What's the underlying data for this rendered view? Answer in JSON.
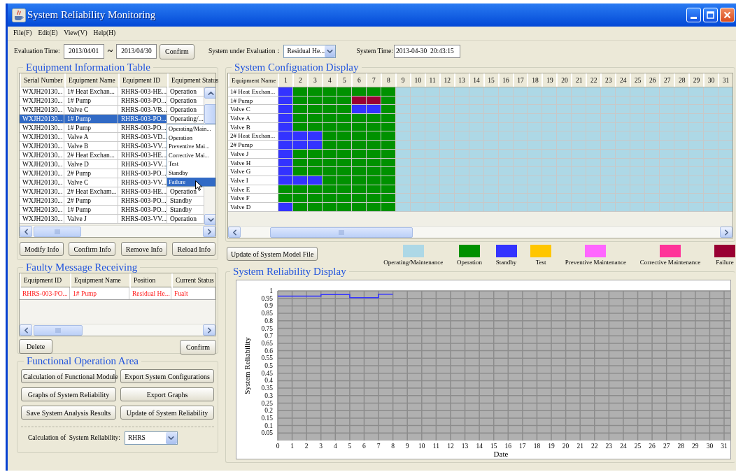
{
  "window": {
    "title": "System Reliability Monitoring"
  },
  "menu": [
    "File(F)",
    "Edit(E)",
    "View(V)",
    "Help(H)"
  ],
  "toolbar": {
    "evaluation_label": "Evaluation Time:",
    "start_date": "2013/04/01",
    "separator": "~",
    "end_date": "2013/04/30",
    "confirm_button": "Confirm",
    "system_label": "System under Evaluation：",
    "system_value": "Residual He...",
    "time_label": "System Time:",
    "time_value": "2013-04-30  20:43:15"
  },
  "equipment_table": {
    "title": "Equipment Information Table",
    "columns": [
      "Serial Number",
      "Equipment Name",
      "Equipment ID",
      "Equipment Status"
    ],
    "rows": [
      {
        "serial": "WXJH20130...",
        "name": "1# Heat Exchan...",
        "id": "RHRS-003-HE...",
        "status": "Operation",
        "selected": false
      },
      {
        "serial": "WXJH20130...",
        "name": "1# Pump",
        "id": "RHRS-003-PO...",
        "status": "Operation",
        "selected": false
      },
      {
        "serial": "WXJH20130...",
        "name": "Valve C",
        "id": "RHRS-003-VB...",
        "status": "Operation",
        "selected": false
      },
      {
        "serial": "WXJH20130...",
        "name": "1# Pump",
        "id": "RHRS-003-PO...",
        "status": "Operating/...",
        "selected": true
      },
      {
        "serial": "WXJH20130...",
        "name": "1# Pump",
        "id": "RHRS-003-PO...",
        "selected": false
      },
      {
        "serial": "WXJH20130...",
        "name": "Valve A",
        "id": "RHRS-003-VD...",
        "selected": false
      },
      {
        "serial": "WXJH20130...",
        "name": "Valve B",
        "id": "RHRS-003-VV...",
        "selected": false
      },
      {
        "serial": "WXJH20130...",
        "name": "2# Heat Exchan...",
        "id": "RHRS-003-HE...",
        "selected": false
      },
      {
        "serial": "WXJH20130...",
        "name": "Valve D",
        "id": "RHRS-003-VV...",
        "selected": false
      },
      {
        "serial": "WXJH20130...",
        "name": "2# Pump",
        "id": "RHRS-003-PO...",
        "selected": false
      },
      {
        "serial": "WXJH20130...",
        "name": "Valve C",
        "id": "RHRS-003-VV...",
        "selected": false
      },
      {
        "serial": "WXJH20130...",
        "name": "2# Heat Excham...",
        "id": "RHRS-003-HE...",
        "status": "Operation",
        "selected": false
      },
      {
        "serial": "WXJH20130...",
        "name": "2# Pump",
        "id": "RHRS-003-PO...",
        "status": "Standby",
        "selected": false
      },
      {
        "serial": "WXJH20130...",
        "name": "1# Pump",
        "id": "RHRS-003-PO...",
        "status": "Standby",
        "selected": false
      },
      {
        "serial": "WXJH20130...",
        "name": "Valve J",
        "id": "RHRS-003-VV...",
        "status": "Operation",
        "selected": false
      }
    ],
    "status_menu": [
      {
        "label": "Operating/Main...",
        "selected": false
      },
      {
        "label": "Operation",
        "selected": false
      },
      {
        "label": "Preventive Mai...",
        "selected": false
      },
      {
        "label": "Corrective Mai...",
        "selected": false
      },
      {
        "label": "Test",
        "selected": false
      },
      {
        "label": "Standby",
        "selected": false
      },
      {
        "label": "Failure",
        "selected": true
      }
    ],
    "buttons": [
      "Modify Info",
      "Confirm Info",
      "Remove Info",
      "Reload Info"
    ]
  },
  "configuration": {
    "title": "System Configuation Display",
    "name_header": "Equipment Name",
    "days": [
      "1",
      "2",
      "3",
      "4",
      "5",
      "6",
      "7",
      "8",
      "9",
      "10",
      "11",
      "12",
      "13",
      "14",
      "15",
      "16",
      "17",
      "18",
      "19",
      "20",
      "21",
      "22",
      "23",
      "24",
      "25",
      "26",
      "27",
      "28",
      "29",
      "30",
      "31"
    ],
    "rows": [
      {
        "name": "1# Heat Exchan...",
        "cells": [
          {
            "kind": "sb"
          },
          {
            "kind": "op"
          },
          {
            "kind": "op"
          },
          {
            "kind": "op"
          },
          {
            "kind": "op"
          },
          {
            "kind": "op"
          },
          {
            "kind": "op"
          },
          {
            "kind": "op"
          },
          {
            "kind": "om"
          },
          {
            "kind": "om"
          },
          {
            "kind": "om"
          },
          {
            "kind": "om"
          },
          {
            "kind": "om"
          },
          {
            "kind": "om"
          },
          {
            "kind": "om"
          },
          {
            "kind": "om"
          },
          {
            "kind": "om"
          },
          {
            "kind": "om"
          },
          {
            "kind": "om"
          },
          {
            "kind": "om"
          },
          {
            "kind": "om"
          },
          {
            "kind": "om"
          },
          {
            "kind": "om"
          },
          {
            "kind": "om"
          },
          {
            "kind": "om"
          },
          {
            "kind": "om"
          },
          {
            "kind": "om"
          },
          {
            "kind": "om"
          },
          {
            "kind": "om"
          },
          {
            "kind": "om"
          },
          {
            "kind": "om"
          }
        ]
      },
      {
        "name": "1# Pump",
        "cells": [
          {
            "kind": "sb"
          },
          {
            "kind": "op"
          },
          {
            "kind": "op"
          },
          {
            "kind": "op"
          },
          {
            "kind": "op"
          },
          {
            "kind": "fl"
          },
          {
            "kind": "fl"
          },
          {
            "kind": "op"
          },
          {
            "kind": "om"
          },
          {
            "kind": "om"
          },
          {
            "kind": "om"
          },
          {
            "kind": "om"
          },
          {
            "kind": "om"
          },
          {
            "kind": "om"
          },
          {
            "kind": "om"
          },
          {
            "kind": "om"
          },
          {
            "kind": "om"
          },
          {
            "kind": "om"
          },
          {
            "kind": "om"
          },
          {
            "kind": "om"
          },
          {
            "kind": "om"
          },
          {
            "kind": "om"
          },
          {
            "kind": "om"
          },
          {
            "kind": "om"
          },
          {
            "kind": "om"
          },
          {
            "kind": "om"
          },
          {
            "kind": "om"
          },
          {
            "kind": "om"
          },
          {
            "kind": "om"
          },
          {
            "kind": "om"
          },
          {
            "kind": "om"
          }
        ]
      },
      {
        "name": "Valve C",
        "cells": [
          {
            "kind": "sb"
          },
          {
            "kind": "op"
          },
          {
            "kind": "op"
          },
          {
            "kind": "op"
          },
          {
            "kind": "op"
          },
          {
            "kind": "sb"
          },
          {
            "kind": "sb"
          },
          {
            "kind": "op"
          },
          {
            "kind": "om"
          },
          {
            "kind": "om"
          },
          {
            "kind": "om"
          },
          {
            "kind": "om"
          },
          {
            "kind": "om"
          },
          {
            "kind": "om"
          },
          {
            "kind": "om"
          },
          {
            "kind": "om"
          },
          {
            "kind": "om"
          },
          {
            "kind": "om"
          },
          {
            "kind": "om"
          },
          {
            "kind": "om"
          },
          {
            "kind": "om"
          },
          {
            "kind": "om"
          },
          {
            "kind": "om"
          },
          {
            "kind": "om"
          },
          {
            "kind": "om"
          },
          {
            "kind": "om"
          },
          {
            "kind": "om"
          },
          {
            "kind": "om"
          },
          {
            "kind": "om"
          },
          {
            "kind": "om"
          },
          {
            "kind": "om"
          }
        ]
      },
      {
        "name": "Valve A",
        "cells": [
          {
            "kind": "sb"
          },
          {
            "kind": "op"
          },
          {
            "kind": "op"
          },
          {
            "kind": "op"
          },
          {
            "kind": "op"
          },
          {
            "kind": "op"
          },
          {
            "kind": "op"
          },
          {
            "kind": "op"
          },
          {
            "kind": "om"
          },
          {
            "kind": "om"
          },
          {
            "kind": "om"
          },
          {
            "kind": "om"
          },
          {
            "kind": "om"
          },
          {
            "kind": "om"
          },
          {
            "kind": "om"
          },
          {
            "kind": "om"
          },
          {
            "kind": "om"
          },
          {
            "kind": "om"
          },
          {
            "kind": "om"
          },
          {
            "kind": "om"
          },
          {
            "kind": "om"
          },
          {
            "kind": "om"
          },
          {
            "kind": "om"
          },
          {
            "kind": "om"
          },
          {
            "kind": "om"
          },
          {
            "kind": "om"
          },
          {
            "kind": "om"
          },
          {
            "kind": "om"
          },
          {
            "kind": "om"
          },
          {
            "kind": "om"
          },
          {
            "kind": "om"
          }
        ]
      },
      {
        "name": "Valve B",
        "cells": [
          {
            "kind": "sb"
          },
          {
            "kind": "op"
          },
          {
            "kind": "op"
          },
          {
            "kind": "op"
          },
          {
            "kind": "op"
          },
          {
            "kind": "op"
          },
          {
            "kind": "op"
          },
          {
            "kind": "op"
          },
          {
            "kind": "om"
          },
          {
            "kind": "om"
          },
          {
            "kind": "om"
          },
          {
            "kind": "om"
          },
          {
            "kind": "om"
          },
          {
            "kind": "om"
          },
          {
            "kind": "om"
          },
          {
            "kind": "om"
          },
          {
            "kind": "om"
          },
          {
            "kind": "om"
          },
          {
            "kind": "om"
          },
          {
            "kind": "om"
          },
          {
            "kind": "om"
          },
          {
            "kind": "om"
          },
          {
            "kind": "om"
          },
          {
            "kind": "om"
          },
          {
            "kind": "om"
          },
          {
            "kind": "om"
          },
          {
            "kind": "om"
          },
          {
            "kind": "om"
          },
          {
            "kind": "om"
          },
          {
            "kind": "om"
          },
          {
            "kind": "om"
          }
        ]
      },
      {
        "name": "2# Heat Exchan...",
        "cells": [
          {
            "kind": "sb"
          },
          {
            "kind": "sb"
          },
          {
            "kind": "sb"
          },
          {
            "kind": "op"
          },
          {
            "kind": "op"
          },
          {
            "kind": "op"
          },
          {
            "kind": "op"
          },
          {
            "kind": "op"
          },
          {
            "kind": "om"
          },
          {
            "kind": "om"
          },
          {
            "kind": "om"
          },
          {
            "kind": "om"
          },
          {
            "kind": "om"
          },
          {
            "kind": "om"
          },
          {
            "kind": "om"
          },
          {
            "kind": "om"
          },
          {
            "kind": "om"
          },
          {
            "kind": "om"
          },
          {
            "kind": "om"
          },
          {
            "kind": "om"
          },
          {
            "kind": "om"
          },
          {
            "kind": "om"
          },
          {
            "kind": "om"
          },
          {
            "kind": "om"
          },
          {
            "kind": "om"
          },
          {
            "kind": "om"
          },
          {
            "kind": "om"
          },
          {
            "kind": "om"
          },
          {
            "kind": "om"
          },
          {
            "kind": "om"
          },
          {
            "kind": "om"
          }
        ]
      },
      {
        "name": "2# Pump",
        "cells": [
          {
            "kind": "sb"
          },
          {
            "kind": "sb"
          },
          {
            "kind": "sb"
          },
          {
            "kind": "op"
          },
          {
            "kind": "op"
          },
          {
            "kind": "op"
          },
          {
            "kind": "op"
          },
          {
            "kind": "op"
          },
          {
            "kind": "om"
          },
          {
            "kind": "om"
          },
          {
            "kind": "om"
          },
          {
            "kind": "om"
          },
          {
            "kind": "om"
          },
          {
            "kind": "om"
          },
          {
            "kind": "om"
          },
          {
            "kind": "om"
          },
          {
            "kind": "om"
          },
          {
            "kind": "om"
          },
          {
            "kind": "om"
          },
          {
            "kind": "om"
          },
          {
            "kind": "om"
          },
          {
            "kind": "om"
          },
          {
            "kind": "om"
          },
          {
            "kind": "om"
          },
          {
            "kind": "om"
          },
          {
            "kind": "om"
          },
          {
            "kind": "om"
          },
          {
            "kind": "om"
          },
          {
            "kind": "om"
          },
          {
            "kind": "om"
          },
          {
            "kind": "om"
          }
        ]
      },
      {
        "name": "Valve J",
        "cells": [
          {
            "kind": "sb"
          },
          {
            "kind": "op"
          },
          {
            "kind": "op"
          },
          {
            "kind": "op"
          },
          {
            "kind": "op"
          },
          {
            "kind": "op"
          },
          {
            "kind": "op"
          },
          {
            "kind": "op"
          },
          {
            "kind": "om"
          },
          {
            "kind": "om"
          },
          {
            "kind": "om"
          },
          {
            "kind": "om"
          },
          {
            "kind": "om"
          },
          {
            "kind": "om"
          },
          {
            "kind": "om"
          },
          {
            "kind": "om"
          },
          {
            "kind": "om"
          },
          {
            "kind": "om"
          },
          {
            "kind": "om"
          },
          {
            "kind": "om"
          },
          {
            "kind": "om"
          },
          {
            "kind": "om"
          },
          {
            "kind": "om"
          },
          {
            "kind": "om"
          },
          {
            "kind": "om"
          },
          {
            "kind": "om"
          },
          {
            "kind": "om"
          },
          {
            "kind": "om"
          },
          {
            "kind": "om"
          },
          {
            "kind": "om"
          },
          {
            "kind": "om"
          }
        ]
      },
      {
        "name": "Valve H",
        "cells": [
          {
            "kind": "sb"
          },
          {
            "kind": "op"
          },
          {
            "kind": "op"
          },
          {
            "kind": "op"
          },
          {
            "kind": "op"
          },
          {
            "kind": "op"
          },
          {
            "kind": "op"
          },
          {
            "kind": "op"
          },
          {
            "kind": "om"
          },
          {
            "kind": "om"
          },
          {
            "kind": "om"
          },
          {
            "kind": "om"
          },
          {
            "kind": "om"
          },
          {
            "kind": "om"
          },
          {
            "kind": "om"
          },
          {
            "kind": "om"
          },
          {
            "kind": "om"
          },
          {
            "kind": "om"
          },
          {
            "kind": "om"
          },
          {
            "kind": "om"
          },
          {
            "kind": "om"
          },
          {
            "kind": "om"
          },
          {
            "kind": "om"
          },
          {
            "kind": "om"
          },
          {
            "kind": "om"
          },
          {
            "kind": "om"
          },
          {
            "kind": "om"
          },
          {
            "kind": "om"
          },
          {
            "kind": "om"
          },
          {
            "kind": "om"
          },
          {
            "kind": "om"
          }
        ]
      },
      {
        "name": "Valve G",
        "cells": [
          {
            "kind": "sb"
          },
          {
            "kind": "op"
          },
          {
            "kind": "op"
          },
          {
            "kind": "op"
          },
          {
            "kind": "op"
          },
          {
            "kind": "op"
          },
          {
            "kind": "op"
          },
          {
            "kind": "op"
          },
          {
            "kind": "om"
          },
          {
            "kind": "om"
          },
          {
            "kind": "om"
          },
          {
            "kind": "om"
          },
          {
            "kind": "om"
          },
          {
            "kind": "om"
          },
          {
            "kind": "om"
          },
          {
            "kind": "om"
          },
          {
            "kind": "om"
          },
          {
            "kind": "om"
          },
          {
            "kind": "om"
          },
          {
            "kind": "om"
          },
          {
            "kind": "om"
          },
          {
            "kind": "om"
          },
          {
            "kind": "om"
          },
          {
            "kind": "om"
          },
          {
            "kind": "om"
          },
          {
            "kind": "om"
          },
          {
            "kind": "om"
          },
          {
            "kind": "om"
          },
          {
            "kind": "om"
          },
          {
            "kind": "om"
          },
          {
            "kind": "om"
          }
        ]
      },
      {
        "name": "Valve I",
        "cells": [
          {
            "kind": "sb"
          },
          {
            "kind": "sb"
          },
          {
            "kind": "sb"
          },
          {
            "kind": "op"
          },
          {
            "kind": "op"
          },
          {
            "kind": "op"
          },
          {
            "kind": "op"
          },
          {
            "kind": "op"
          },
          {
            "kind": "om"
          },
          {
            "kind": "om"
          },
          {
            "kind": "om"
          },
          {
            "kind": "om"
          },
          {
            "kind": "om"
          },
          {
            "kind": "om"
          },
          {
            "kind": "om"
          },
          {
            "kind": "om"
          },
          {
            "kind": "om"
          },
          {
            "kind": "om"
          },
          {
            "kind": "om"
          },
          {
            "kind": "om"
          },
          {
            "kind": "om"
          },
          {
            "kind": "om"
          },
          {
            "kind": "om"
          },
          {
            "kind": "om"
          },
          {
            "kind": "om"
          },
          {
            "kind": "om"
          },
          {
            "kind": "om"
          },
          {
            "kind": "om"
          },
          {
            "kind": "om"
          },
          {
            "kind": "om"
          },
          {
            "kind": "om"
          }
        ]
      },
      {
        "name": "Valve E",
        "cells": [
          {
            "kind": "op"
          },
          {
            "kind": "op"
          },
          {
            "kind": "op"
          },
          {
            "kind": "op"
          },
          {
            "kind": "op"
          },
          {
            "kind": "op"
          },
          {
            "kind": "op"
          },
          {
            "kind": "op"
          },
          {
            "kind": "om"
          },
          {
            "kind": "om"
          },
          {
            "kind": "om"
          },
          {
            "kind": "om"
          },
          {
            "kind": "om"
          },
          {
            "kind": "om"
          },
          {
            "kind": "om"
          },
          {
            "kind": "om"
          },
          {
            "kind": "om"
          },
          {
            "kind": "om"
          },
          {
            "kind": "om"
          },
          {
            "kind": "om"
          },
          {
            "kind": "om"
          },
          {
            "kind": "om"
          },
          {
            "kind": "om"
          },
          {
            "kind": "om"
          },
          {
            "kind": "om"
          },
          {
            "kind": "om"
          },
          {
            "kind": "om"
          },
          {
            "kind": "om"
          },
          {
            "kind": "om"
          },
          {
            "kind": "om"
          },
          {
            "kind": "om"
          }
        ]
      },
      {
        "name": "Valve F",
        "cells": [
          {
            "kind": "op"
          },
          {
            "kind": "op"
          },
          {
            "kind": "op"
          },
          {
            "kind": "op"
          },
          {
            "kind": "op"
          },
          {
            "kind": "op"
          },
          {
            "kind": "op"
          },
          {
            "kind": "op"
          },
          {
            "kind": "om"
          },
          {
            "kind": "om"
          },
          {
            "kind": "om"
          },
          {
            "kind": "om"
          },
          {
            "kind": "om"
          },
          {
            "kind": "om"
          },
          {
            "kind": "om"
          },
          {
            "kind": "om"
          },
          {
            "kind": "om"
          },
          {
            "kind": "om"
          },
          {
            "kind": "om"
          },
          {
            "kind": "om"
          },
          {
            "kind": "om"
          },
          {
            "kind": "om"
          },
          {
            "kind": "om"
          },
          {
            "kind": "om"
          },
          {
            "kind": "om"
          },
          {
            "kind": "om"
          },
          {
            "kind": "om"
          },
          {
            "kind": "om"
          },
          {
            "kind": "om"
          },
          {
            "kind": "om"
          },
          {
            "kind": "om"
          }
        ]
      },
      {
        "name": "Valve D",
        "cells": [
          {
            "kind": "sb"
          },
          {
            "kind": "op"
          },
          {
            "kind": "op"
          },
          {
            "kind": "op"
          },
          {
            "kind": "op"
          },
          {
            "kind": "op"
          },
          {
            "kind": "op"
          },
          {
            "kind": "op"
          },
          {
            "kind": "om"
          },
          {
            "kind": "om"
          },
          {
            "kind": "om"
          },
          {
            "kind": "om"
          },
          {
            "kind": "om"
          },
          {
            "kind": "om"
          },
          {
            "kind": "om"
          },
          {
            "kind": "om"
          },
          {
            "kind": "om"
          },
          {
            "kind": "om"
          },
          {
            "kind": "om"
          },
          {
            "kind": "om"
          },
          {
            "kind": "om"
          },
          {
            "kind": "om"
          },
          {
            "kind": "om"
          },
          {
            "kind": "om"
          },
          {
            "kind": "om"
          },
          {
            "kind": "om"
          },
          {
            "kind": "om"
          },
          {
            "kind": "om"
          },
          {
            "kind": "om"
          },
          {
            "kind": "om"
          },
          {
            "kind": "om"
          }
        ]
      }
    ],
    "update_button": "Update of System Model File",
    "legend": [
      {
        "kind": "om",
        "label": "Operating/Maintenance",
        "color": "#add8e6"
      },
      {
        "kind": "op",
        "label": "Operation",
        "color": "#009100"
      },
      {
        "kind": "sb",
        "label": "Standby",
        "color": "#3333ff"
      },
      {
        "kind": "ts",
        "label": "Test",
        "color": "#ffc600"
      },
      {
        "kind": "pm",
        "label": "Preventive Maintenance",
        "color": "#ff66ff"
      },
      {
        "kind": "cm",
        "label": "Corrective Maintenance",
        "color": "#ff3399"
      },
      {
        "kind": "fl",
        "label": "Failure",
        "color": "#990033"
      }
    ]
  },
  "faulty": {
    "title": "Faulty Message Receiving",
    "columns": [
      "Equipment ID",
      "Equipment Name",
      "Position",
      "Current Status"
    ],
    "rows": [
      {
        "id": "RHRS-003-PO...",
        "name": "1# Pump",
        "position": "Residual He...",
        "status": "Fualt"
      }
    ],
    "buttons": [
      "Delete",
      "Confirm"
    ]
  },
  "functions": {
    "title": "Functional Operation Area",
    "buttons": [
      "Calculation of Functional Module",
      "Export System Configurations",
      "Graphs of System Reliability",
      "Export Graphs",
      "Save System Analysis Results",
      "Update of System Reliability"
    ],
    "calc_label": "Calculation of  System Reliability:",
    "calc_value": "RHRS"
  },
  "reliability": {
    "title": "System Reliability Display",
    "chart_data": {
      "type": "line",
      "xlabel": "Date",
      "ylabel": "System Reliability",
      "xlim": [
        0,
        31
      ],
      "ylim": [
        0,
        1
      ],
      "grid": true,
      "xticks": [
        0,
        1,
        2,
        3,
        4,
        5,
        6,
        7,
        8,
        9,
        10,
        11,
        12,
        13,
        14,
        15,
        16,
        17,
        18,
        19,
        20,
        21,
        22,
        23,
        24,
        25,
        26,
        27,
        28,
        29,
        30,
        31
      ],
      "yticks": [
        0.05,
        0.1,
        0.15,
        0.2,
        0.25,
        0.3,
        0.35,
        0.4,
        0.45,
        0.5,
        0.55,
        0.6,
        0.65,
        0.7,
        0.75,
        0.8,
        0.85,
        0.9,
        0.95,
        1
      ],
      "x": [
        0,
        3,
        3,
        5,
        5,
        7,
        7,
        8
      ],
      "series": [
        {
          "color": "#3333ff",
          "values": [
            0.965,
            0.965,
            0.975,
            0.975,
            0.955,
            0.955,
            0.978,
            0.978
          ]
        }
      ]
    }
  }
}
